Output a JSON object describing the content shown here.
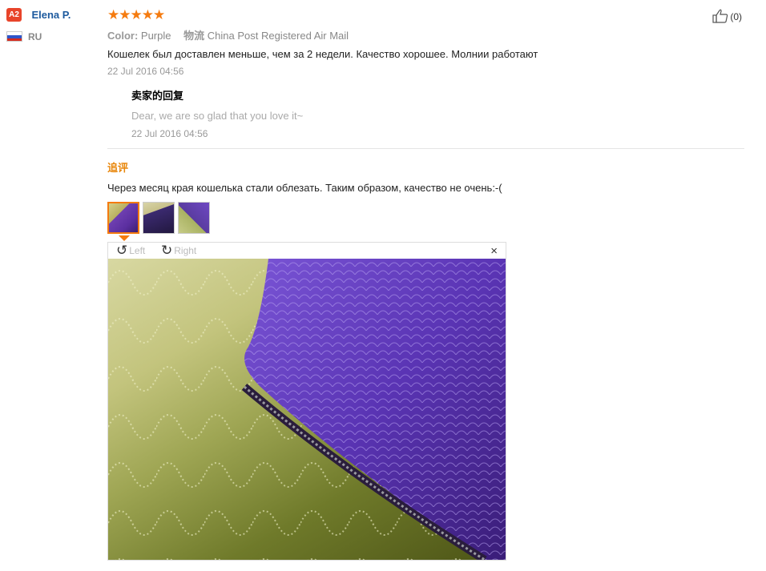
{
  "user": {
    "badge": "A2",
    "name": "Elena P.",
    "country": "RU"
  },
  "review": {
    "stars": "★★★★★",
    "rating": 5,
    "color_label": "Color:",
    "color_value": "Purple",
    "shipping_label": "物流",
    "shipping_value": "China Post Registered Air Mail",
    "text": "Кошелек был доставлен меньше, чем за 2 недели. Качество хорошее. Молнии работают",
    "date": "22 Jul 2016 04:56"
  },
  "seller_reply": {
    "title": "卖家的回复",
    "text": "Dear, we are so glad that you love it~",
    "date": "22 Jul 2016 04:56"
  },
  "followup": {
    "title": "追评",
    "text": "Через месяц края кошелька стали облезать. Таким образом, качество не очень:-("
  },
  "viewer": {
    "rotate_left": "Left",
    "rotate_right": "Right",
    "close": "×"
  },
  "likes": {
    "count": "(0)"
  },
  "colors": {
    "accent": "#f57b0f",
    "name": "#1d5a9e",
    "followup": "#e8860a"
  }
}
